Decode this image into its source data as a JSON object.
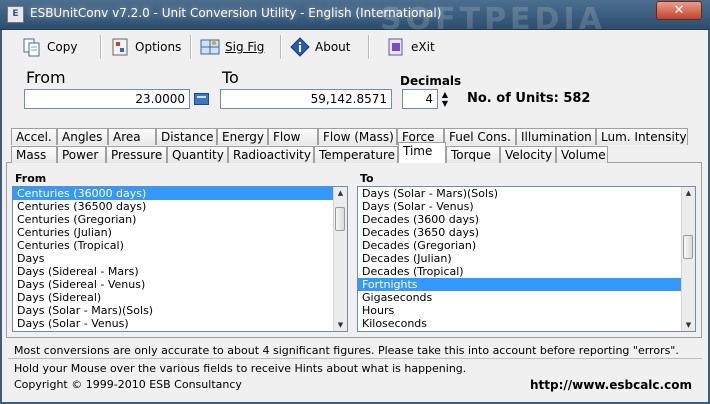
{
  "window": {
    "title": "ESBUnitConv v7.2.0 - Unit Conversion Utility - English (International)",
    "watermark": "SOFTPEDIA",
    "close": "✕"
  },
  "toolbar": {
    "copy": "Copy",
    "options": "Options",
    "sigfig": "Sig Fig",
    "about": "About",
    "exit": "eXit"
  },
  "converter": {
    "from_label": "From",
    "from_value": "23.0000",
    "to_label": "To",
    "to_value": "59,142.8571",
    "decimals_label": "Decimals",
    "decimals_value": "4",
    "units_count": "No. of Units: 582"
  },
  "tabs_row1": [
    "Accel.",
    "Angles",
    "Area",
    "Distance",
    "Energy",
    "Flow",
    "Flow (Mass)",
    "Force",
    "Fuel Cons.",
    "Illumination",
    "Lum. Intensity"
  ],
  "tabs_row2": [
    "Mass",
    "Power",
    "Pressure",
    "Quantity",
    "Radioactivity",
    "Temperature",
    "Time",
    "Torque",
    "Velocity",
    "Volume"
  ],
  "active_tab": "Time",
  "from_list": {
    "label": "From",
    "items": [
      "Centuries (36000 days)",
      "Centuries (36500 days)",
      "Centuries (Gregorian)",
      "Centuries (Julian)",
      "Centuries (Tropical)",
      "Days",
      "Days (Sidereal - Mars)",
      "Days (Sidereal - Venus)",
      "Days (Sidereal)",
      "Days (Solar - Mars)(Sols)",
      "Days (Solar - Venus)"
    ],
    "selected": "Centuries (36000 days)"
  },
  "to_list": {
    "label": "To",
    "items": [
      "Days (Solar - Mars)(Sols)",
      "Days (Solar - Venus)",
      "Decades (3600 days)",
      "Decades (3650 days)",
      "Decades (Gregorian)",
      "Decades (Julian)",
      "Decades (Tropical)",
      "Fortnights",
      "Gigaseconds",
      "Hours",
      "Kiloseconds"
    ],
    "selected": "Fortnights"
  },
  "status": {
    "hint1": "Most conversions are only accurate to about 4 significant figures. Please take this into account before reporting \"errors\".",
    "hint2": "Hold your Mouse over the various fields to receive Hints about what is happening.",
    "copyright": "Copyright © 1999-2010 ESB Consultancy",
    "url": "http://www.esbcalc.com"
  },
  "colors": {
    "selection": "#3399ff",
    "titlebar": "#3b5d7d"
  }
}
